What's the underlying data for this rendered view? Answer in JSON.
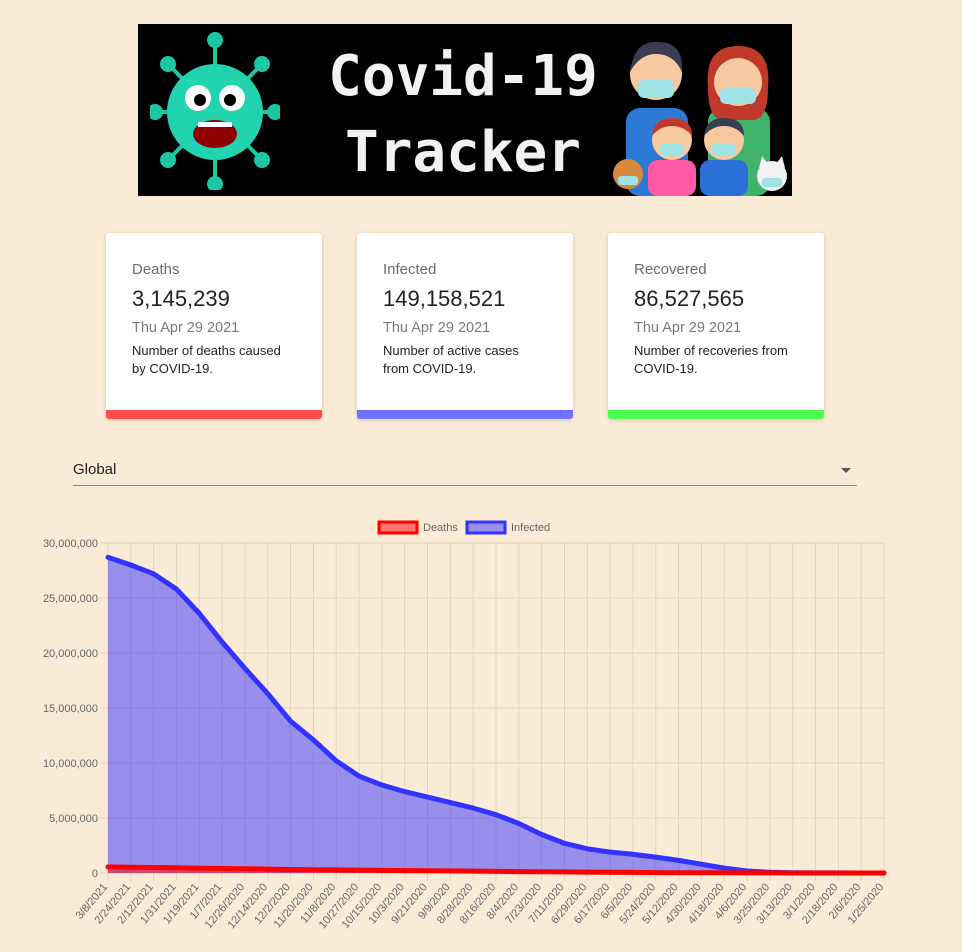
{
  "banner": {
    "title_line1": "Covid-19",
    "title_line2": "Tracker"
  },
  "cards": [
    {
      "title": "Deaths",
      "value": "3,145,239",
      "date": "Thu Apr 29 2021",
      "description": "Number of deaths caused by COVID-19.",
      "color": "#ff4d4d"
    },
    {
      "title": "Infected",
      "value": "149,158,521",
      "date": "Thu Apr 29 2021",
      "description": "Number of active cases from COVID-19.",
      "color": "#7070ff"
    },
    {
      "title": "Recovered",
      "value": "86,527,565",
      "date": "Thu Apr 29 2021",
      "description": "Number of recoveries from COVID-19.",
      "color": "#4dff4d"
    }
  ],
  "country_select": {
    "value": "Global"
  },
  "chart_data": {
    "type": "line",
    "x": [
      "3/8/2021",
      "2/24/2021",
      "2/12/2021",
      "1/31/2021",
      "1/19/2021",
      "1/7/2021",
      "12/26/2020",
      "12/14/2020",
      "12/2/2020",
      "11/20/2020",
      "11/8/2020",
      "10/27/2020",
      "10/15/2020",
      "10/3/2020",
      "9/21/2020",
      "9/9/2020",
      "8/28/2020",
      "8/16/2020",
      "8/4/2020",
      "7/23/2020",
      "7/11/2020",
      "6/29/2020",
      "6/17/2020",
      "6/5/2020",
      "5/24/2020",
      "5/12/2020",
      "4/30/2020",
      "4/18/2020",
      "4/6/2020",
      "3/25/2020",
      "3/13/2020",
      "3/1/2020",
      "2/18/2020",
      "2/6/2020",
      "1/25/2020"
    ],
    "series": [
      {
        "name": "Deaths",
        "color": "#ff0000",
        "fill": "rgba(255,0,0,0.5)",
        "values": [
          550000,
          520000,
          500000,
          470000,
          440000,
          410000,
          380000,
          350000,
          320000,
          300000,
          280000,
          260000,
          240000,
          220000,
          200000,
          190000,
          170000,
          150000,
          130000,
          110000,
          100000,
          80000,
          60000,
          50000,
          40000,
          30000,
          20000,
          15000,
          10000,
          5000,
          2000,
          1000,
          500,
          200,
          0
        ]
      },
      {
        "name": "Infected",
        "color": "#3333ff",
        "fill": "rgba(51,51,255,0.5)",
        "values": [
          28700000,
          28000000,
          27200000,
          25800000,
          23600000,
          21000000,
          18600000,
          16300000,
          13800000,
          12100000,
          10200000,
          8800000,
          8000000,
          7400000,
          6900000,
          6400000,
          5900000,
          5300000,
          4500000,
          3500000,
          2700000,
          2200000,
          1900000,
          1700000,
          1450000,
          1150000,
          800000,
          450000,
          180000,
          60000,
          20000,
          10000,
          5000,
          2000,
          500
        ]
      }
    ],
    "ylim": [
      0,
      30000000
    ],
    "yticks": [
      "0",
      "5,000,000",
      "10,000,000",
      "15,000,000",
      "20,000,000",
      "25,000,000",
      "30,000,000"
    ],
    "ytick_values": [
      0,
      5000000,
      10000000,
      15000000,
      20000000,
      25000000,
      30000000
    ],
    "legend": "top-center",
    "grid": true
  }
}
